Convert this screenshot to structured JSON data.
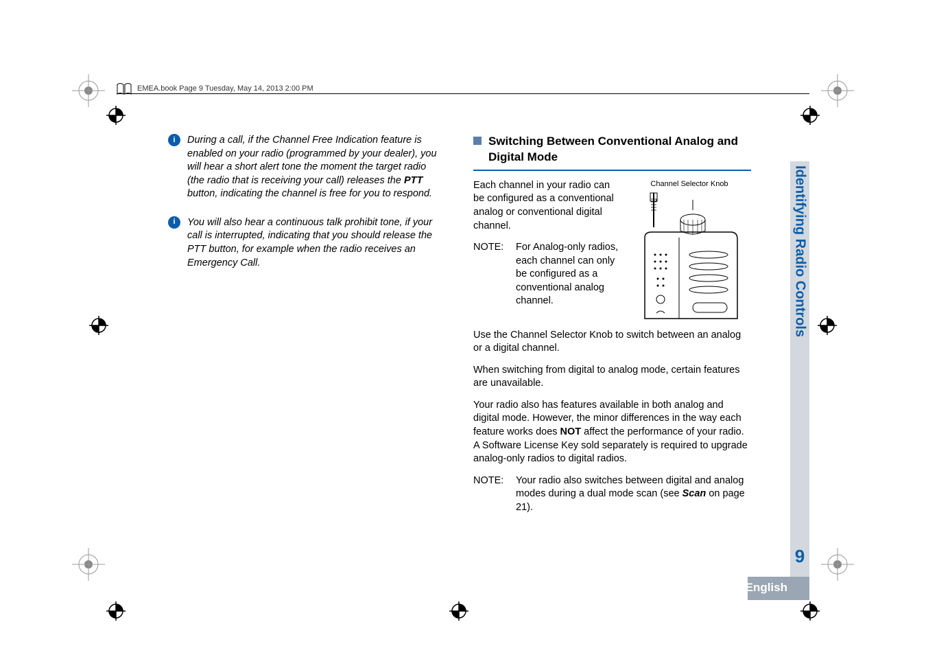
{
  "header": "EMEA.book  Page 9  Tuesday, May 14, 2013  2:00 PM",
  "left": {
    "note1_a": "During a call, if the Channel Free Indication feature is enabled on your radio (programmed by your dealer), you will hear a short alert tone the moment the target radio (the radio that is receiving your call) releases the ",
    "ptt": "PTT",
    "note1_b": " button, indicating the channel is free for you to respond.",
    "note2": "You will also hear a continuous talk prohibit tone, if your call is interrupted, indicating that you should release the PTT button, for example when the radio receives an Emergency Call."
  },
  "right": {
    "heading": "Switching Between Conventional Analog and Digital Mode",
    "knob_label": "Channel Selector Knob",
    "p1": "Each channel in your radio can be configured as a conventional analog or conventional digital channel.",
    "note1_label": "NOTE:",
    "note1_body": "For Analog-only radios, each channel can only be configured as a conventional analog channel.",
    "p2": "Use the Channel Selector Knob to switch between an analog or a digital channel.",
    "p3": "When switching from digital to analog mode, certain features are unavailable.",
    "p4_a": "Your radio also has features available in both analog and digital mode. However, the minor differences in the way each feature works does ",
    "not": "NOT",
    "p4_b": " affect the performance of your radio. A Software License Key sold separately is required to upgrade analog-only radios to digital radios.",
    "note2_label": "NOTE:",
    "note2_a": "Your radio also switches between digital and analog modes during a dual mode scan (see ",
    "scan": "Scan",
    "note2_b": " on page 21)."
  },
  "side_label": "Identifying Radio Controls",
  "page_number": "9",
  "language": "English"
}
